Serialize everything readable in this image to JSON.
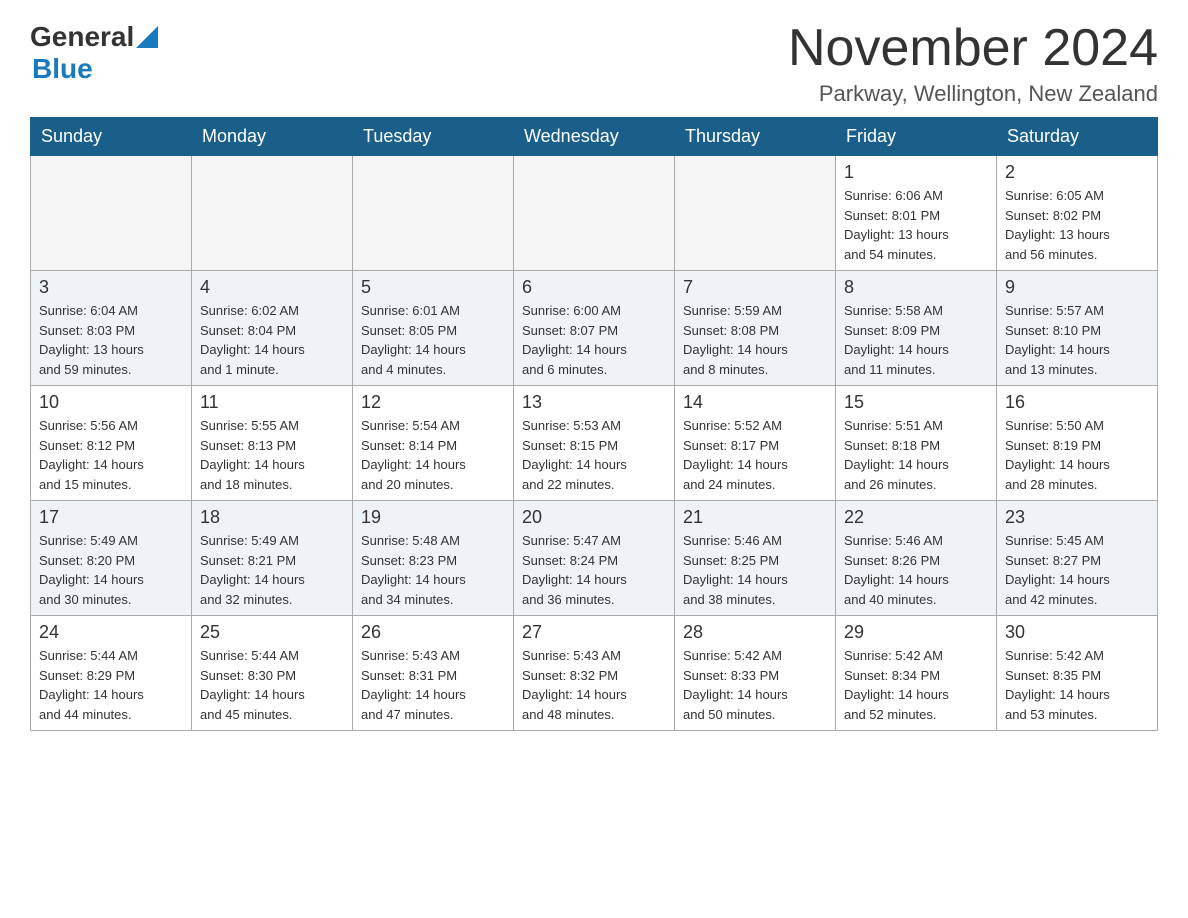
{
  "header": {
    "logo": {
      "general_text": "General",
      "blue_text": "Blue"
    },
    "title": "November 2024",
    "location": "Parkway, Wellington, New Zealand"
  },
  "calendar": {
    "days_of_week": [
      "Sunday",
      "Monday",
      "Tuesday",
      "Wednesday",
      "Thursday",
      "Friday",
      "Saturday"
    ],
    "weeks": [
      [
        {
          "day": "",
          "info": ""
        },
        {
          "day": "",
          "info": ""
        },
        {
          "day": "",
          "info": ""
        },
        {
          "day": "",
          "info": ""
        },
        {
          "day": "",
          "info": ""
        },
        {
          "day": "1",
          "info": "Sunrise: 6:06 AM\nSunset: 8:01 PM\nDaylight: 13 hours\nand 54 minutes."
        },
        {
          "day": "2",
          "info": "Sunrise: 6:05 AM\nSunset: 8:02 PM\nDaylight: 13 hours\nand 56 minutes."
        }
      ],
      [
        {
          "day": "3",
          "info": "Sunrise: 6:04 AM\nSunset: 8:03 PM\nDaylight: 13 hours\nand 59 minutes."
        },
        {
          "day": "4",
          "info": "Sunrise: 6:02 AM\nSunset: 8:04 PM\nDaylight: 14 hours\nand 1 minute."
        },
        {
          "day": "5",
          "info": "Sunrise: 6:01 AM\nSunset: 8:05 PM\nDaylight: 14 hours\nand 4 minutes."
        },
        {
          "day": "6",
          "info": "Sunrise: 6:00 AM\nSunset: 8:07 PM\nDaylight: 14 hours\nand 6 minutes."
        },
        {
          "day": "7",
          "info": "Sunrise: 5:59 AM\nSunset: 8:08 PM\nDaylight: 14 hours\nand 8 minutes."
        },
        {
          "day": "8",
          "info": "Sunrise: 5:58 AM\nSunset: 8:09 PM\nDaylight: 14 hours\nand 11 minutes."
        },
        {
          "day": "9",
          "info": "Sunrise: 5:57 AM\nSunset: 8:10 PM\nDaylight: 14 hours\nand 13 minutes."
        }
      ],
      [
        {
          "day": "10",
          "info": "Sunrise: 5:56 AM\nSunset: 8:12 PM\nDaylight: 14 hours\nand 15 minutes."
        },
        {
          "day": "11",
          "info": "Sunrise: 5:55 AM\nSunset: 8:13 PM\nDaylight: 14 hours\nand 18 minutes."
        },
        {
          "day": "12",
          "info": "Sunrise: 5:54 AM\nSunset: 8:14 PM\nDaylight: 14 hours\nand 20 minutes."
        },
        {
          "day": "13",
          "info": "Sunrise: 5:53 AM\nSunset: 8:15 PM\nDaylight: 14 hours\nand 22 minutes."
        },
        {
          "day": "14",
          "info": "Sunrise: 5:52 AM\nSunset: 8:17 PM\nDaylight: 14 hours\nand 24 minutes."
        },
        {
          "day": "15",
          "info": "Sunrise: 5:51 AM\nSunset: 8:18 PM\nDaylight: 14 hours\nand 26 minutes."
        },
        {
          "day": "16",
          "info": "Sunrise: 5:50 AM\nSunset: 8:19 PM\nDaylight: 14 hours\nand 28 minutes."
        }
      ],
      [
        {
          "day": "17",
          "info": "Sunrise: 5:49 AM\nSunset: 8:20 PM\nDaylight: 14 hours\nand 30 minutes."
        },
        {
          "day": "18",
          "info": "Sunrise: 5:49 AM\nSunset: 8:21 PM\nDaylight: 14 hours\nand 32 minutes."
        },
        {
          "day": "19",
          "info": "Sunrise: 5:48 AM\nSunset: 8:23 PM\nDaylight: 14 hours\nand 34 minutes."
        },
        {
          "day": "20",
          "info": "Sunrise: 5:47 AM\nSunset: 8:24 PM\nDaylight: 14 hours\nand 36 minutes."
        },
        {
          "day": "21",
          "info": "Sunrise: 5:46 AM\nSunset: 8:25 PM\nDaylight: 14 hours\nand 38 minutes."
        },
        {
          "day": "22",
          "info": "Sunrise: 5:46 AM\nSunset: 8:26 PM\nDaylight: 14 hours\nand 40 minutes."
        },
        {
          "day": "23",
          "info": "Sunrise: 5:45 AM\nSunset: 8:27 PM\nDaylight: 14 hours\nand 42 minutes."
        }
      ],
      [
        {
          "day": "24",
          "info": "Sunrise: 5:44 AM\nSunset: 8:29 PM\nDaylight: 14 hours\nand 44 minutes."
        },
        {
          "day": "25",
          "info": "Sunrise: 5:44 AM\nSunset: 8:30 PM\nDaylight: 14 hours\nand 45 minutes."
        },
        {
          "day": "26",
          "info": "Sunrise: 5:43 AM\nSunset: 8:31 PM\nDaylight: 14 hours\nand 47 minutes."
        },
        {
          "day": "27",
          "info": "Sunrise: 5:43 AM\nSunset: 8:32 PM\nDaylight: 14 hours\nand 48 minutes."
        },
        {
          "day": "28",
          "info": "Sunrise: 5:42 AM\nSunset: 8:33 PM\nDaylight: 14 hours\nand 50 minutes."
        },
        {
          "day": "29",
          "info": "Sunrise: 5:42 AM\nSunset: 8:34 PM\nDaylight: 14 hours\nand 52 minutes."
        },
        {
          "day": "30",
          "info": "Sunrise: 5:42 AM\nSunset: 8:35 PM\nDaylight: 14 hours\nand 53 minutes."
        }
      ]
    ]
  }
}
